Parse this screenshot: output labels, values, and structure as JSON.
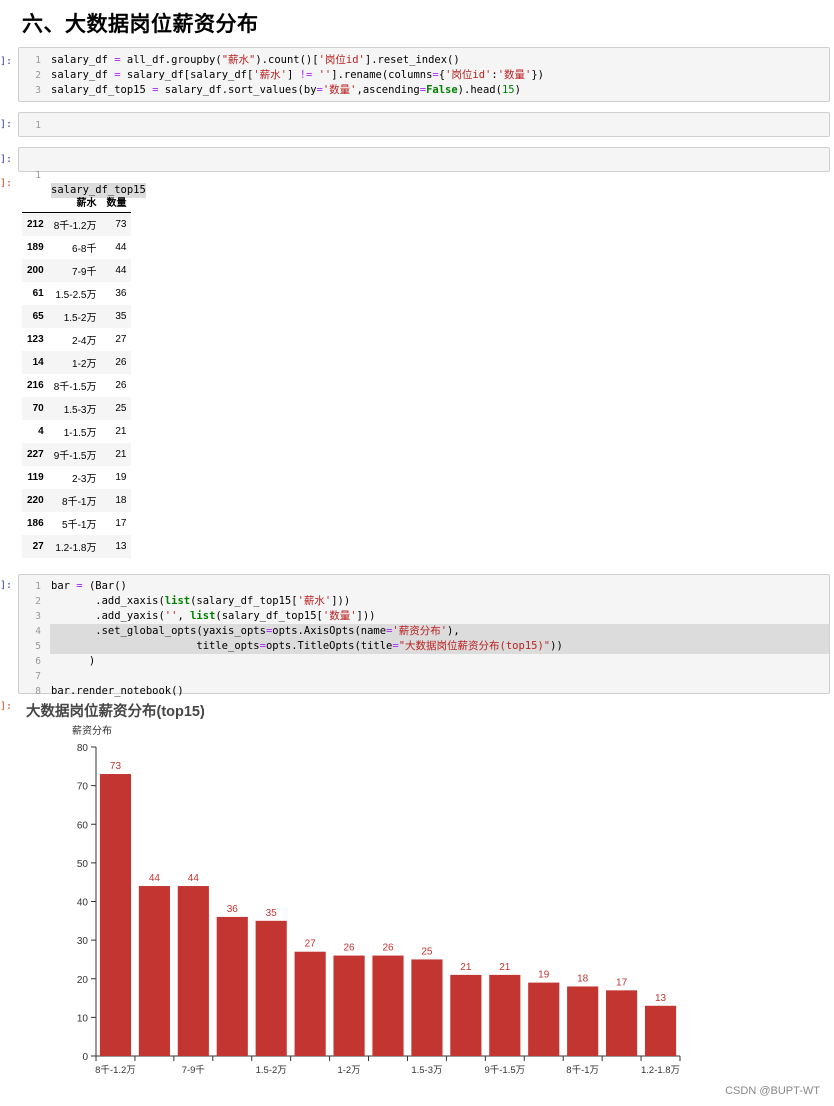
{
  "heading": "六、大数据岗位薪资分布",
  "prompts": {
    "in1": "]:",
    "in2": "]:",
    "in3": "]:",
    "out3": "]:",
    "in4": "]:",
    "out4": "]:"
  },
  "cell1": {
    "numbers": [
      "1",
      "2",
      "3"
    ],
    "lines": [
      [
        [
          "t",
          "salary_df "
        ],
        [
          "o",
          "="
        ],
        [
          "t",
          " all_df.groupby("
        ],
        [
          "s",
          "\"薪水\""
        ],
        [
          "t",
          ").count()["
        ],
        [
          "s",
          "'岗位id'"
        ],
        [
          "t",
          "].reset_index()"
        ]
      ],
      [
        [
          "t",
          "salary_df "
        ],
        [
          "o",
          "="
        ],
        [
          "t",
          " salary_df[salary_df["
        ],
        [
          "s",
          "'薪水'"
        ],
        [
          "t",
          "] "
        ],
        [
          "o",
          "!="
        ],
        [
          "t",
          " "
        ],
        [
          "s",
          "''"
        ],
        [
          "t",
          "].rename(columns"
        ],
        [
          "o",
          "="
        ],
        [
          "t",
          "{"
        ],
        [
          "s",
          "'岗位id'"
        ],
        [
          "t",
          ":"
        ],
        [
          "s",
          "'数量'"
        ],
        [
          "t",
          "})"
        ]
      ],
      [
        [
          "t",
          "salary_df_top15 "
        ],
        [
          "o",
          "="
        ],
        [
          "t",
          " salary_df.sort_values(by"
        ],
        [
          "o",
          "="
        ],
        [
          "s",
          "'数量'"
        ],
        [
          "t",
          ",ascending"
        ],
        [
          "o",
          "="
        ],
        [
          "k",
          "False"
        ],
        [
          "t",
          ").head("
        ],
        [
          "n",
          "15"
        ],
        [
          "t",
          ")"
        ]
      ]
    ]
  },
  "cell2": {
    "numbers": [
      "1"
    ]
  },
  "cell3": {
    "numbers": [
      "1"
    ],
    "code": "salary_df_top15"
  },
  "dataframe": {
    "columns": [
      "薪水",
      "数量"
    ],
    "rows": [
      {
        "index": "212",
        "salary": "8千-1.2万",
        "count": "73"
      },
      {
        "index": "189",
        "salary": "6-8千",
        "count": "44"
      },
      {
        "index": "200",
        "salary": "7-9千",
        "count": "44"
      },
      {
        "index": "61",
        "salary": "1.5-2.5万",
        "count": "36"
      },
      {
        "index": "65",
        "salary": "1.5-2万",
        "count": "35"
      },
      {
        "index": "123",
        "salary": "2-4万",
        "count": "27"
      },
      {
        "index": "14",
        "salary": "1-2万",
        "count": "26"
      },
      {
        "index": "216",
        "salary": "8千-1.5万",
        "count": "26"
      },
      {
        "index": "70",
        "salary": "1.5-3万",
        "count": "25"
      },
      {
        "index": "4",
        "salary": "1-1.5万",
        "count": "21"
      },
      {
        "index": "227",
        "salary": "9千-1.5万",
        "count": "21"
      },
      {
        "index": "119",
        "salary": "2-3万",
        "count": "19"
      },
      {
        "index": "220",
        "salary": "8千-1万",
        "count": "18"
      },
      {
        "index": "186",
        "salary": "5千-1万",
        "count": "17"
      },
      {
        "index": "27",
        "salary": "1.2-1.8万",
        "count": "13"
      }
    ]
  },
  "cell4": {
    "numbers": [
      "1",
      "2",
      "3",
      "4",
      "5",
      "6",
      "7",
      "8"
    ],
    "lines": [
      [
        [
          "t",
          "bar "
        ],
        [
          "o",
          "="
        ],
        [
          "t",
          " (Bar()"
        ]
      ],
      [
        [
          "t",
          "       .add_xaxis("
        ],
        [
          "k2",
          "list"
        ],
        [
          "t",
          "(salary_df_top15["
        ],
        [
          "s",
          "'薪水'"
        ],
        [
          "t",
          "]))"
        ]
      ],
      [
        [
          "t",
          "       .add_yaxis("
        ],
        [
          "s",
          "''"
        ],
        [
          "t",
          ", "
        ],
        [
          "k2",
          "list"
        ],
        [
          "t",
          "(salary_df_top15["
        ],
        [
          "s",
          "'数量'"
        ],
        [
          "t",
          "]))"
        ]
      ],
      [
        [
          "t",
          "       .set_global_opts(yaxis_opts"
        ],
        [
          "o",
          "="
        ],
        [
          "t",
          "opts.AxisOpts(name"
        ],
        [
          "o",
          "="
        ],
        [
          "s",
          "'薪资分布'"
        ],
        [
          "t",
          "),"
        ]
      ],
      [
        [
          "t",
          "                       title_opts"
        ],
        [
          "o",
          "="
        ],
        [
          "t",
          "opts.TitleOpts(title"
        ],
        [
          "o",
          "="
        ],
        [
          "s",
          "\"大数据岗位薪资分布(top15)\""
        ],
        [
          "t",
          "))"
        ]
      ],
      [
        [
          "t",
          "      )"
        ]
      ],
      [
        [
          "t",
          ""
        ]
      ],
      [
        [
          "t",
          "bar.render_notebook()"
        ]
      ]
    ]
  },
  "chart_data": {
    "type": "bar",
    "title": "大数据岗位薪资分布(top15)",
    "ylabel": "薪资分布",
    "xlabel": "",
    "ylim": [
      0,
      80
    ],
    "yticks": [
      0,
      10,
      20,
      30,
      40,
      50,
      60,
      70,
      80
    ],
    "categories": [
      "8千-1.2万",
      "6-8千",
      "7-9千",
      "1.5-2.5万",
      "1.5-2万",
      "2-4万",
      "1-2万",
      "8千-1.5万",
      "1.5-3万",
      "1-1.5万",
      "9千-1.5万",
      "2-3万",
      "8千-1万",
      "5千-1万",
      "1.2-1.8万"
    ],
    "x_tick_labels_shown": [
      "8千-1.2万",
      "7-9千",
      "1.5-2万",
      "1-2万",
      "1.5-3万",
      "9千-1.5万",
      "8千-1万",
      "1.2-1.8万"
    ],
    "values": [
      73,
      44,
      44,
      36,
      35,
      27,
      26,
      26,
      25,
      21,
      21,
      19,
      18,
      17,
      13
    ],
    "bar_color": "#c23531",
    "data_labels": true,
    "grid": false
  },
  "watermark": "CSDN @BUPT-WT"
}
